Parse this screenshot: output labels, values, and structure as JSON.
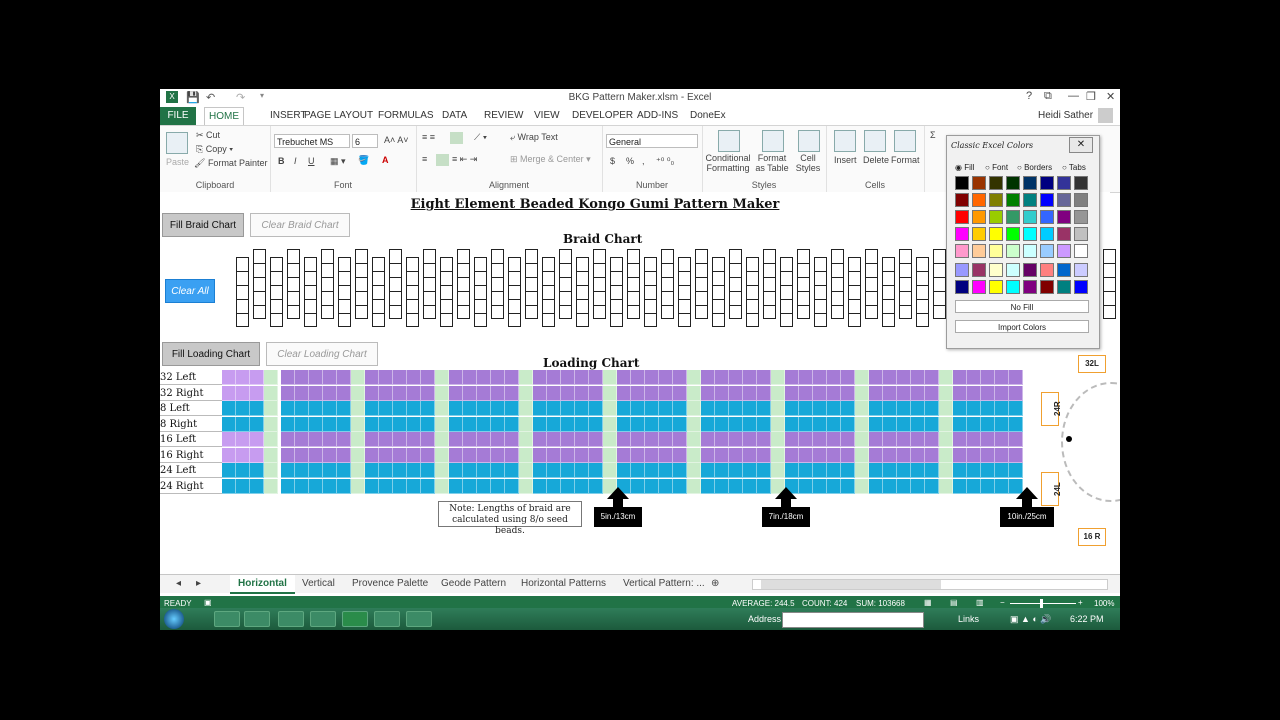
{
  "window": {
    "title": "BKG Pattern Maker.xlsm - Excel",
    "user": "Heidi Sather",
    "controls": [
      "?",
      "⧉",
      "—",
      "❐",
      "✕"
    ]
  },
  "ribbon_tabs": [
    "FILE",
    "HOME",
    "INSERT",
    "PAGE LAYOUT",
    "FORMULAS",
    "DATA",
    "REVIEW",
    "VIEW",
    "DEVELOPER",
    "ADD-INS",
    "DoneEx"
  ],
  "clipboard": {
    "paste": "Paste",
    "cut": "Cut",
    "copy": "Copy",
    "format_painter": "Format Painter",
    "label": "Clipboard"
  },
  "font": {
    "name": "Trebuchet MS",
    "size": "6",
    "bold": "B",
    "italic": "I",
    "underline": "U",
    "label": "Font"
  },
  "alignment": {
    "wrap": "Wrap Text",
    "merge": "Merge & Center",
    "label": "Alignment"
  },
  "number": {
    "format": "General",
    "label": "Number",
    "dollar": "$",
    "percent": "%",
    "comma": ","
  },
  "styles": {
    "conditional": "Conditional Formatting",
    "table": "Format as Table",
    "cell": "Cell Styles",
    "label": "Styles"
  },
  "cells": {
    "insert": "Insert",
    "delete": "Delete",
    "format": "Format",
    "label": "Cells"
  },
  "sheet": {
    "title": "Eight Element Beaded Kongo Gumi Pattern Maker",
    "braid_title": "Braid Chart",
    "loading_title": "Loading Chart",
    "fill_braid": "Fill Braid Chart",
    "clear_braid": "Clear Braid Chart",
    "clear_all": "Clear All",
    "fill_loading": "Fill Loading Chart",
    "clear_loading": "Clear Loading Chart",
    "note": "Note: Lengths of braid are calculated using 8/o seed beads.",
    "rows": [
      "32 Left",
      "32 Right",
      "8 Left",
      "8 Right",
      "16 Left",
      "16 Right",
      "24 Left",
      "24 Right"
    ],
    "markers": [
      "5in./13cm",
      "7in./18cm",
      "10in./25cm"
    ],
    "side_labels": {
      "top": "32L",
      "r24": "24R",
      "l24": "24L",
      "bottom": "16 R"
    }
  },
  "palette": {
    "title": "Classic Excel Colors",
    "options": [
      "Fill",
      "Font",
      "Borders",
      "Tabs"
    ],
    "no_fill": "No Fill",
    "import": "Import Colors",
    "colors": [
      "#000000",
      "#993300",
      "#333300",
      "#003300",
      "#003366",
      "#000080",
      "#333399",
      "#333333",
      "#800000",
      "#ff6600",
      "#808000",
      "#008000",
      "#008080",
      "#0000ff",
      "#666699",
      "#808080",
      "#ff0000",
      "#ff9900",
      "#99cc00",
      "#339966",
      "#33cccc",
      "#3366ff",
      "#800080",
      "#969696",
      "#ff00ff",
      "#ffcc00",
      "#ffff00",
      "#00ff00",
      "#00ffff",
      "#00ccff",
      "#993366",
      "#c0c0c0",
      "#ff99cc",
      "#ffcc99",
      "#ffff99",
      "#ccffcc",
      "#ccffff",
      "#99ccff",
      "#cc99ff",
      "#ffffff",
      "#9999ff",
      "#993366",
      "#ffffcc",
      "#ccffff",
      "#660066",
      "#ff8080",
      "#0066cc",
      "#ccccff",
      "#000080",
      "#ff00ff",
      "#ffff00",
      "#00ffff",
      "#800080",
      "#800000",
      "#008080",
      "#0000ff"
    ]
  },
  "sheet_tabs": [
    "Horizontal",
    "Vertical",
    "Provence Palette",
    "Geode Pattern",
    "Horizontal Patterns",
    "Vertical Pattern: ..."
  ],
  "status": {
    "ready": "READY",
    "average": "AVERAGE: 244.5",
    "count": "COUNT: 424",
    "sum": "SUM: 103668",
    "zoom": "100%"
  },
  "taskbar": {
    "address": "Address",
    "links": "Links",
    "time": "6:22 PM"
  },
  "loading_colors": {
    "purple": "#a57bd6",
    "blue": "#17a8d8",
    "green": "#c9ebc9",
    "lilac": "#c79cf0"
  }
}
